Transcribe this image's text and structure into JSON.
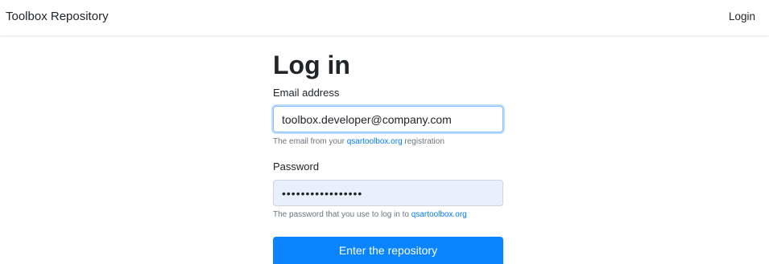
{
  "navbar": {
    "brand": "Toolbox Repository",
    "login_link": "Login"
  },
  "form": {
    "title": "Log in",
    "email": {
      "label": "Email address",
      "value": "toolbox.developer@company.com",
      "help_prefix": "The email from your ",
      "help_link": "qsartoolbox.org",
      "help_suffix": " registration"
    },
    "password": {
      "label": "Password",
      "value": "•••••••••••••••••",
      "help_prefix": "The password that you use to log in to ",
      "help_link": "qsartoolbox.org"
    },
    "submit_label": "Enter the repository"
  },
  "colors": {
    "primary": "#0a84ff",
    "link": "#007bff",
    "autofill_bg": "#e8f0fe",
    "focus_border": "#80bdff"
  }
}
